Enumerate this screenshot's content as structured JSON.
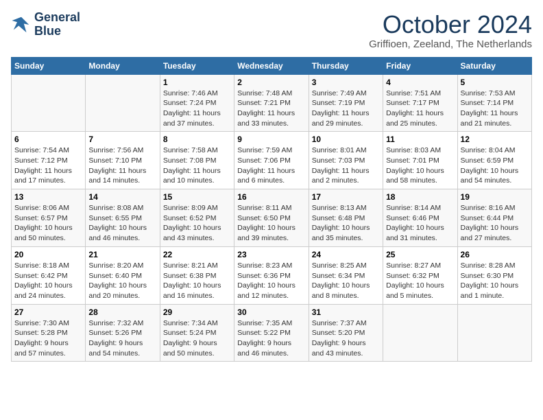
{
  "logo": {
    "line1": "General",
    "line2": "Blue"
  },
  "title": "October 2024",
  "location": "Griffioen, Zeeland, The Netherlands",
  "weekdays": [
    "Sunday",
    "Monday",
    "Tuesday",
    "Wednesday",
    "Thursday",
    "Friday",
    "Saturday"
  ],
  "weeks": [
    [
      {
        "day": "",
        "info": ""
      },
      {
        "day": "",
        "info": ""
      },
      {
        "day": "1",
        "info": "Sunrise: 7:46 AM\nSunset: 7:24 PM\nDaylight: 11 hours\nand 37 minutes."
      },
      {
        "day": "2",
        "info": "Sunrise: 7:48 AM\nSunset: 7:21 PM\nDaylight: 11 hours\nand 33 minutes."
      },
      {
        "day": "3",
        "info": "Sunrise: 7:49 AM\nSunset: 7:19 PM\nDaylight: 11 hours\nand 29 minutes."
      },
      {
        "day": "4",
        "info": "Sunrise: 7:51 AM\nSunset: 7:17 PM\nDaylight: 11 hours\nand 25 minutes."
      },
      {
        "day": "5",
        "info": "Sunrise: 7:53 AM\nSunset: 7:14 PM\nDaylight: 11 hours\nand 21 minutes."
      }
    ],
    [
      {
        "day": "6",
        "info": "Sunrise: 7:54 AM\nSunset: 7:12 PM\nDaylight: 11 hours\nand 17 minutes."
      },
      {
        "day": "7",
        "info": "Sunrise: 7:56 AM\nSunset: 7:10 PM\nDaylight: 11 hours\nand 14 minutes."
      },
      {
        "day": "8",
        "info": "Sunrise: 7:58 AM\nSunset: 7:08 PM\nDaylight: 11 hours\nand 10 minutes."
      },
      {
        "day": "9",
        "info": "Sunrise: 7:59 AM\nSunset: 7:06 PM\nDaylight: 11 hours\nand 6 minutes."
      },
      {
        "day": "10",
        "info": "Sunrise: 8:01 AM\nSunset: 7:03 PM\nDaylight: 11 hours\nand 2 minutes."
      },
      {
        "day": "11",
        "info": "Sunrise: 8:03 AM\nSunset: 7:01 PM\nDaylight: 10 hours\nand 58 minutes."
      },
      {
        "day": "12",
        "info": "Sunrise: 8:04 AM\nSunset: 6:59 PM\nDaylight: 10 hours\nand 54 minutes."
      }
    ],
    [
      {
        "day": "13",
        "info": "Sunrise: 8:06 AM\nSunset: 6:57 PM\nDaylight: 10 hours\nand 50 minutes."
      },
      {
        "day": "14",
        "info": "Sunrise: 8:08 AM\nSunset: 6:55 PM\nDaylight: 10 hours\nand 46 minutes."
      },
      {
        "day": "15",
        "info": "Sunrise: 8:09 AM\nSunset: 6:52 PM\nDaylight: 10 hours\nand 43 minutes."
      },
      {
        "day": "16",
        "info": "Sunrise: 8:11 AM\nSunset: 6:50 PM\nDaylight: 10 hours\nand 39 minutes."
      },
      {
        "day": "17",
        "info": "Sunrise: 8:13 AM\nSunset: 6:48 PM\nDaylight: 10 hours\nand 35 minutes."
      },
      {
        "day": "18",
        "info": "Sunrise: 8:14 AM\nSunset: 6:46 PM\nDaylight: 10 hours\nand 31 minutes."
      },
      {
        "day": "19",
        "info": "Sunrise: 8:16 AM\nSunset: 6:44 PM\nDaylight: 10 hours\nand 27 minutes."
      }
    ],
    [
      {
        "day": "20",
        "info": "Sunrise: 8:18 AM\nSunset: 6:42 PM\nDaylight: 10 hours\nand 24 minutes."
      },
      {
        "day": "21",
        "info": "Sunrise: 8:20 AM\nSunset: 6:40 PM\nDaylight: 10 hours\nand 20 minutes."
      },
      {
        "day": "22",
        "info": "Sunrise: 8:21 AM\nSunset: 6:38 PM\nDaylight: 10 hours\nand 16 minutes."
      },
      {
        "day": "23",
        "info": "Sunrise: 8:23 AM\nSunset: 6:36 PM\nDaylight: 10 hours\nand 12 minutes."
      },
      {
        "day": "24",
        "info": "Sunrise: 8:25 AM\nSunset: 6:34 PM\nDaylight: 10 hours\nand 8 minutes."
      },
      {
        "day": "25",
        "info": "Sunrise: 8:27 AM\nSunset: 6:32 PM\nDaylight: 10 hours\nand 5 minutes."
      },
      {
        "day": "26",
        "info": "Sunrise: 8:28 AM\nSunset: 6:30 PM\nDaylight: 10 hours\nand 1 minute."
      }
    ],
    [
      {
        "day": "27",
        "info": "Sunrise: 7:30 AM\nSunset: 5:28 PM\nDaylight: 9 hours\nand 57 minutes."
      },
      {
        "day": "28",
        "info": "Sunrise: 7:32 AM\nSunset: 5:26 PM\nDaylight: 9 hours\nand 54 minutes."
      },
      {
        "day": "29",
        "info": "Sunrise: 7:34 AM\nSunset: 5:24 PM\nDaylight: 9 hours\nand 50 minutes."
      },
      {
        "day": "30",
        "info": "Sunrise: 7:35 AM\nSunset: 5:22 PM\nDaylight: 9 hours\nand 46 minutes."
      },
      {
        "day": "31",
        "info": "Sunrise: 7:37 AM\nSunset: 5:20 PM\nDaylight: 9 hours\nand 43 minutes."
      },
      {
        "day": "",
        "info": ""
      },
      {
        "day": "",
        "info": ""
      }
    ]
  ]
}
